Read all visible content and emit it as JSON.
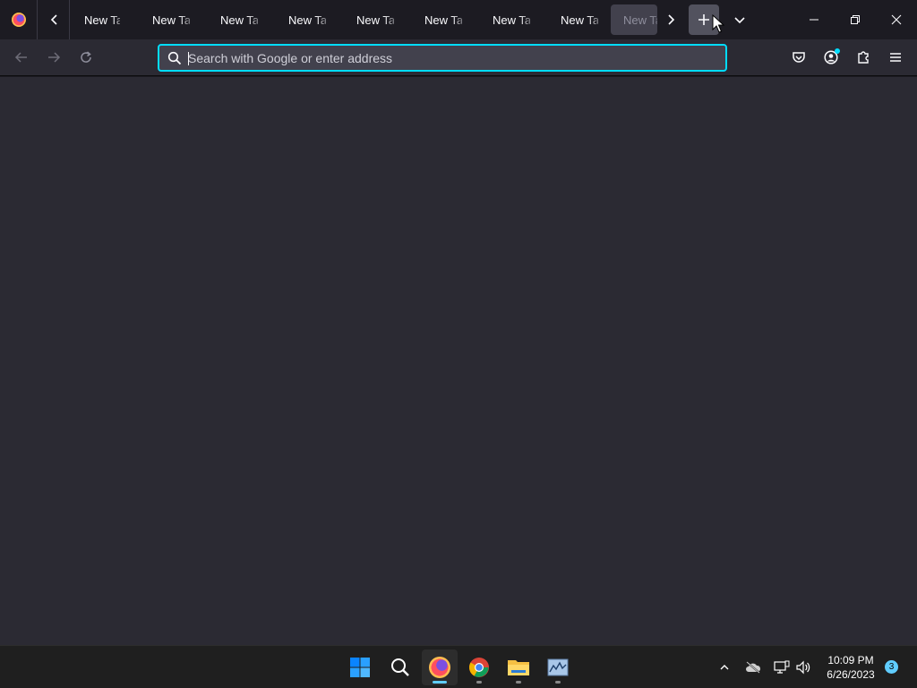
{
  "browser": {
    "tabs": [
      {
        "label": "New Tab",
        "active": false
      },
      {
        "label": "New Tab",
        "active": false
      },
      {
        "label": "New Tab",
        "active": false
      },
      {
        "label": "New Tab",
        "active": false
      },
      {
        "label": "New Tab",
        "active": false
      },
      {
        "label": "New Tab",
        "active": false
      },
      {
        "label": "New Tab",
        "active": false
      },
      {
        "label": "New Tab",
        "active": false
      },
      {
        "label": "New Tab",
        "active": true
      }
    ],
    "new_tab_icon": "plus-icon",
    "list_all_tabs_icon": "chevron-down-icon"
  },
  "urlbar": {
    "placeholder": "Search with Google or enter address",
    "value": ""
  },
  "colors": {
    "accent": "#00ddff",
    "toolbar": "#2b2a33",
    "tabstrip": "#1c1b22"
  },
  "taskbar": {
    "apps": [
      "start-icon",
      "search-icon",
      "firefox-icon",
      "chrome-icon",
      "file-explorer-icon",
      "resource-monitor-icon"
    ],
    "time": "10:09 PM",
    "date": "6/26/2023",
    "notification_count": "3"
  }
}
